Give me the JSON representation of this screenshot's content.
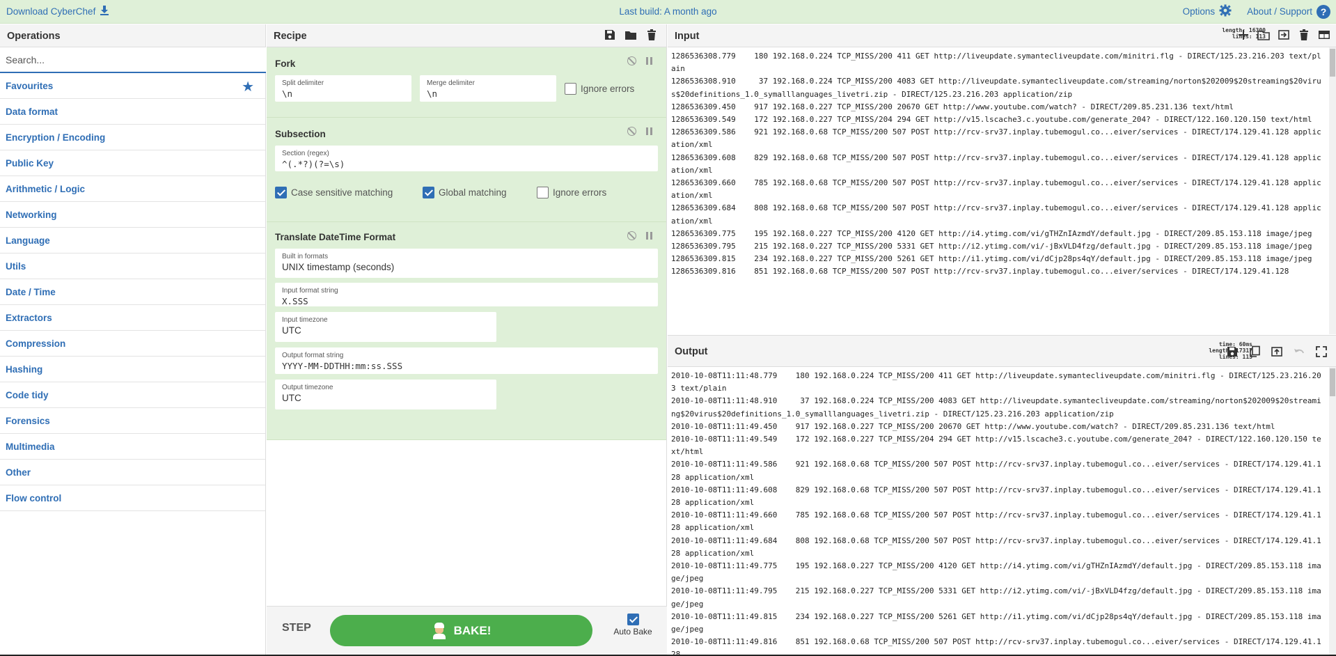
{
  "banner": {
    "download": "Download CyberChef",
    "last_build": "Last build: A month ago",
    "options": "Options",
    "about": "About / Support"
  },
  "operations": {
    "title": "Operations",
    "search_placeholder": "Search...",
    "categories": [
      "Favourites",
      "Data format",
      "Encryption / Encoding",
      "Public Key",
      "Arithmetic / Logic",
      "Networking",
      "Language",
      "Utils",
      "Date / Time",
      "Extractors",
      "Compression",
      "Hashing",
      "Code tidy",
      "Forensics",
      "Multimedia",
      "Other",
      "Flow control"
    ]
  },
  "recipe": {
    "title": "Recipe",
    "fork": {
      "title": "Fork",
      "split_label": "Split delimiter",
      "split_value": "\\n",
      "merge_label": "Merge delimiter",
      "merge_value": "\\n",
      "ignore_errors": "Ignore errors",
      "ignore_checked": false
    },
    "subsection": {
      "title": "Subsection",
      "section_label": "Section (regex)",
      "section_value": "^(.*?)(?=\\s)",
      "case_sensitive": "Case sensitive matching",
      "case_checked": true,
      "global": "Global matching",
      "global_checked": true,
      "ignore_errors": "Ignore errors",
      "ignore_checked": false
    },
    "translate": {
      "title": "Translate DateTime Format",
      "builtin_label": "Built in formats",
      "builtin_value": "UNIX timestamp (seconds)",
      "input_format_label": "Input format string",
      "input_format_value": "X.SSS",
      "input_tz_label": "Input timezone",
      "input_tz_value": "UTC",
      "output_format_label": "Output format string",
      "output_format_value": "YYYY-MM-DDTHH:mm:ss.SSS",
      "output_tz_label": "Output timezone",
      "output_tz_value": "UTC"
    },
    "step": "STEP",
    "bake": "BAKE!",
    "auto_bake": "Auto Bake",
    "auto_bake_checked": true
  },
  "input": {
    "title": "Input",
    "length_label": "length:",
    "length": "16300",
    "lines_label": "lines:",
    "lines": "113",
    "text": "1286536308.779    180 192.168.0.224 TCP_MISS/200 411 GET http://liveupdate.symantecliveupdate.com/minitri.flg - DIRECT/125.23.216.203 text/plain\n1286536308.910     37 192.168.0.224 TCP_MISS/200 4083 GET http://liveupdate.symantecliveupdate.com/streaming/norton$202009$20streaming$20virus$20definitions_1.0_symalllanguages_livetri.zip - DIRECT/125.23.216.203 application/zip\n1286536309.450    917 192.168.0.227 TCP_MISS/200 20670 GET http://www.youtube.com/watch? - DIRECT/209.85.231.136 text/html\n1286536309.549    172 192.168.0.227 TCP_MISS/204 294 GET http://v15.lscache3.c.youtube.com/generate_204? - DIRECT/122.160.120.150 text/html\n1286536309.586    921 192.168.0.68 TCP_MISS/200 507 POST http://rcv-srv37.inplay.tubemogul.co...eiver/services - DIRECT/174.129.41.128 application/xml\n1286536309.608    829 192.168.0.68 TCP_MISS/200 507 POST http://rcv-srv37.inplay.tubemogul.co...eiver/services - DIRECT/174.129.41.128 application/xml\n1286536309.660    785 192.168.0.68 TCP_MISS/200 507 POST http://rcv-srv37.inplay.tubemogul.co...eiver/services - DIRECT/174.129.41.128 application/xml\n1286536309.684    808 192.168.0.68 TCP_MISS/200 507 POST http://rcv-srv37.inplay.tubemogul.co...eiver/services - DIRECT/174.129.41.128 application/xml\n1286536309.775    195 192.168.0.227 TCP_MISS/200 4120 GET http://i4.ytimg.com/vi/gTHZnIAzmdY/default.jpg - DIRECT/209.85.153.118 image/jpeg\n1286536309.795    215 192.168.0.227 TCP_MISS/200 5331 GET http://i2.ytimg.com/vi/-jBxVLD4fzg/default.jpg - DIRECT/209.85.153.118 image/jpeg\n1286536309.815    234 192.168.0.227 TCP_MISS/200 5261 GET http://i1.ytimg.com/vi/dCjp28ps4qY/default.jpg - DIRECT/209.85.153.118 image/jpeg\n1286536309.816    851 192.168.0.68 TCP_MISS/200 507 POST http://rcv-srv37.inplay.tubemogul.co...eiver/services - DIRECT/174.129.41.128"
  },
  "output": {
    "title": "Output",
    "time_label": "time:",
    "time": "60ms",
    "length_label": "length:",
    "length": "17317",
    "lines_label": "lines:",
    "lines": "113",
    "text": "2010-10-08T11:11:48.779    180 192.168.0.224 TCP_MISS/200 411 GET http://liveupdate.symantecliveupdate.com/minitri.flg - DIRECT/125.23.216.203 text/plain\n2010-10-08T11:11:48.910     37 192.168.0.224 TCP_MISS/200 4083 GET http://liveupdate.symantecliveupdate.com/streaming/norton$202009$20streaming$20virus$20definitions_1.0_symalllanguages_livetri.zip - DIRECT/125.23.216.203 application/zip\n2010-10-08T11:11:49.450    917 192.168.0.227 TCP_MISS/200 20670 GET http://www.youtube.com/watch? - DIRECT/209.85.231.136 text/html\n2010-10-08T11:11:49.549    172 192.168.0.227 TCP_MISS/204 294 GET http://v15.lscache3.c.youtube.com/generate_204? - DIRECT/122.160.120.150 text/html\n2010-10-08T11:11:49.586    921 192.168.0.68 TCP_MISS/200 507 POST http://rcv-srv37.inplay.tubemogul.co...eiver/services - DIRECT/174.129.41.128 application/xml\n2010-10-08T11:11:49.608    829 192.168.0.68 TCP_MISS/200 507 POST http://rcv-srv37.inplay.tubemogul.co...eiver/services - DIRECT/174.129.41.128 application/xml\n2010-10-08T11:11:49.660    785 192.168.0.68 TCP_MISS/200 507 POST http://rcv-srv37.inplay.tubemogul.co...eiver/services - DIRECT/174.129.41.128 application/xml\n2010-10-08T11:11:49.684    808 192.168.0.68 TCP_MISS/200 507 POST http://rcv-srv37.inplay.tubemogul.co...eiver/services - DIRECT/174.129.41.128 application/xml\n2010-10-08T11:11:49.775    195 192.168.0.227 TCP_MISS/200 4120 GET http://i4.ytimg.com/vi/gTHZnIAzmdY/default.jpg - DIRECT/209.85.153.118 image/jpeg\n2010-10-08T11:11:49.795    215 192.168.0.227 TCP_MISS/200 5331 GET http://i2.ytimg.com/vi/-jBxVLD4fzg/default.jpg - DIRECT/209.85.153.118 image/jpeg\n2010-10-08T11:11:49.815    234 192.168.0.227 TCP_MISS/200 5261 GET http://i1.ytimg.com/vi/dCjp28ps4qY/default.jpg - DIRECT/209.85.153.118 image/jpeg\n2010-10-08T11:11:49.816    851 192.168.0.68 TCP_MISS/200 507 POST http://rcv-srv37.inplay.tubemogul.co...eiver/services - DIRECT/174.129.41.128"
  },
  "colors": {
    "accent": "#2f6eb5",
    "recipe_bg": "#dff0d8",
    "bake": "#4cae4c"
  }
}
